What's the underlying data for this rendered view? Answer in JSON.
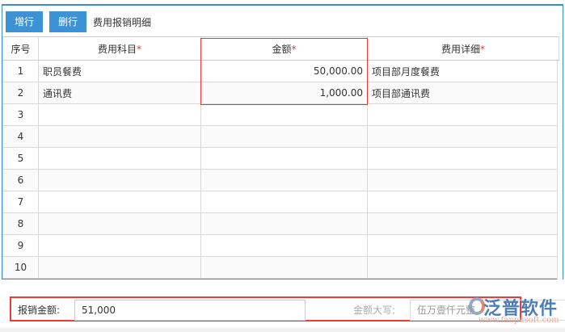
{
  "toolbar": {
    "add_row": "增行",
    "delete_row": "删行",
    "title": "费用报销明细"
  },
  "table": {
    "headers": {
      "index": "序号",
      "subject": "费用科目",
      "amount": "金额",
      "detail": "费用详细",
      "required_mark": "*"
    },
    "rows": [
      {
        "index": "1",
        "subject": "职员餐费",
        "amount": "50,000.00",
        "detail": "项目部月度餐费"
      },
      {
        "index": "2",
        "subject": "通讯费",
        "amount": "1,000.00",
        "detail": "项目部通讯费"
      },
      {
        "index": "3",
        "subject": "",
        "amount": "",
        "detail": ""
      },
      {
        "index": "4",
        "subject": "",
        "amount": "",
        "detail": ""
      },
      {
        "index": "5",
        "subject": "",
        "amount": "",
        "detail": ""
      },
      {
        "index": "6",
        "subject": "",
        "amount": "",
        "detail": ""
      },
      {
        "index": "7",
        "subject": "",
        "amount": "",
        "detail": ""
      },
      {
        "index": "8",
        "subject": "",
        "amount": "",
        "detail": ""
      },
      {
        "index": "9",
        "subject": "",
        "amount": "",
        "detail": ""
      },
      {
        "index": "10",
        "subject": "",
        "amount": "",
        "detail": ""
      }
    ]
  },
  "summary": {
    "total_label": "报销金额:",
    "total_value": "51,000",
    "uppercase_label": "金额大写:",
    "uppercase_value": "伍万壹仟元整"
  },
  "watermark": {
    "brand": "泛普软件",
    "url": "www.fanpusoft.com"
  },
  "colors": {
    "accent": "#3d92d6",
    "highlight": "#f03a3a"
  }
}
